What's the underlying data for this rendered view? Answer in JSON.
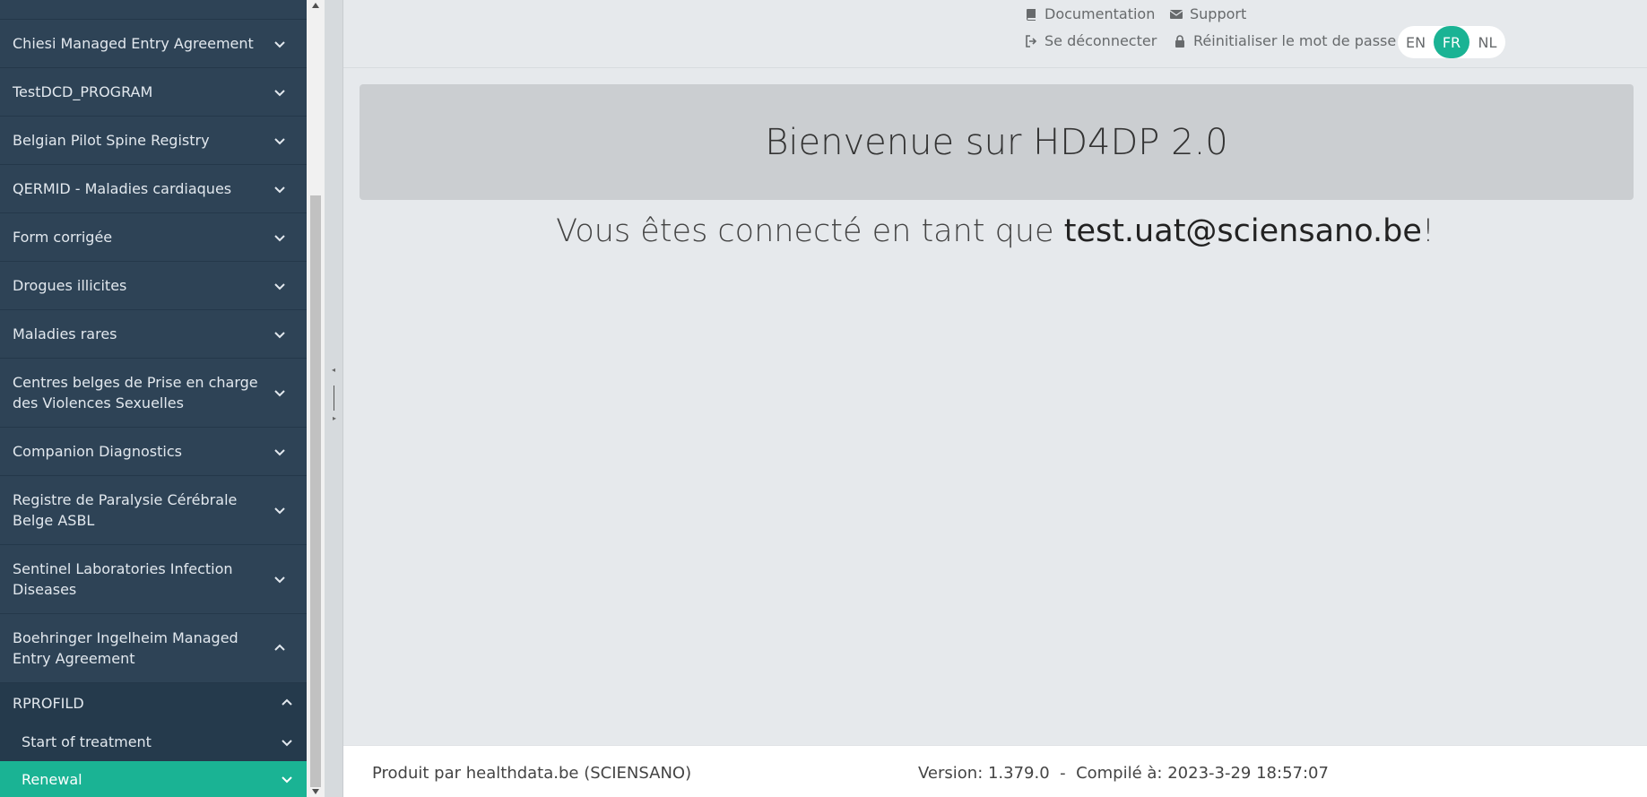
{
  "sidebar": {
    "items": [
      {
        "label": "Chiesi Managed Entry Agreement",
        "expanded": false
      },
      {
        "label": "TestDCD_PROGRAM",
        "expanded": false
      },
      {
        "label": "Belgian Pilot Spine Registry",
        "expanded": false
      },
      {
        "label": "QERMID - Maladies cardiaques",
        "expanded": false
      },
      {
        "label": "Form corrigée",
        "expanded": false
      },
      {
        "label": "Drogues illicites",
        "expanded": false
      },
      {
        "label": "Maladies rares",
        "expanded": false
      },
      {
        "label": "Centres belges de Prise en charge des Violences Sexuelles",
        "expanded": false
      },
      {
        "label": "Companion Diagnostics",
        "expanded": false
      },
      {
        "label": "Registre de Paralysie Cérébrale Belge ASBL",
        "expanded": false
      },
      {
        "label": "Sentinel Laboratories Infection Diseases",
        "expanded": false
      },
      {
        "label": "Boehringer Ingelheim Managed Entry Agreement",
        "expanded": true
      }
    ],
    "sub_items": {
      "group": "RPROFILD",
      "children": [
        "Start of treatment",
        "Renewal"
      ],
      "active": "Renewal"
    }
  },
  "header": {
    "documentation": "Documentation",
    "support": "Support",
    "logout": "Se déconnecter",
    "reset_password": "Réinitialiser le mot de passe",
    "languages": [
      "EN",
      "FR",
      "NL"
    ],
    "active_language": "FR"
  },
  "main": {
    "welcome_title": "Bienvenue sur HD4DP 2.0",
    "logged_prefix": "Vous êtes connecté en tant que ",
    "user_email": "test.uat@sciensano.be",
    "logged_suffix": "!"
  },
  "footer": {
    "produced_by": "Produit par healthdata.be (SCIENSANO)",
    "version": "Version: 1.379.0  -  Compilé à: 2023-3-29 18:57:07"
  },
  "colors": {
    "sidebar_bg": "#2e4356",
    "accent": "#1ab394",
    "panel_bg": "#cbced1",
    "page_bg": "#e6e9ec"
  }
}
